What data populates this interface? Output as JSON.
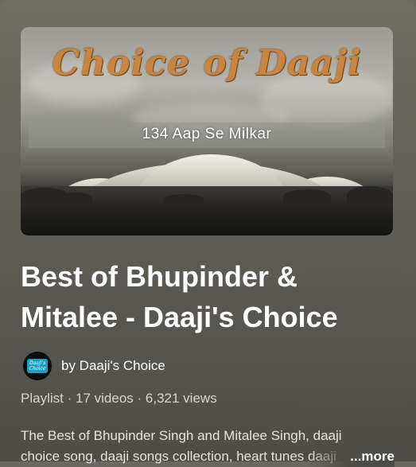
{
  "thumbnail": {
    "logo_text": "Choice of Daaji",
    "caption": "134 Aap Se Milkar"
  },
  "playlist": {
    "title": "Best of Bhupinder & Mitalee - Daaji's Choice",
    "channel_label": "by Daaji's Choice",
    "avatar_text": "Daaji's Choice",
    "type": "Playlist",
    "video_count": "17 videos",
    "views": "6,321 views",
    "separator": "·",
    "description_line1": "The Best of Bhupinder Singh and Mitalee Singh, daaji",
    "description_line2": "choice song, daaji songs collection, heart tunes daaji",
    "more_label": "...more"
  },
  "colors": {
    "background": "#5a5852",
    "text_primary": "#ffffff",
    "text_secondary": "#d8d6d0",
    "logo_accent": "#c9853f",
    "avatar_accent": "#1a9ec1"
  }
}
